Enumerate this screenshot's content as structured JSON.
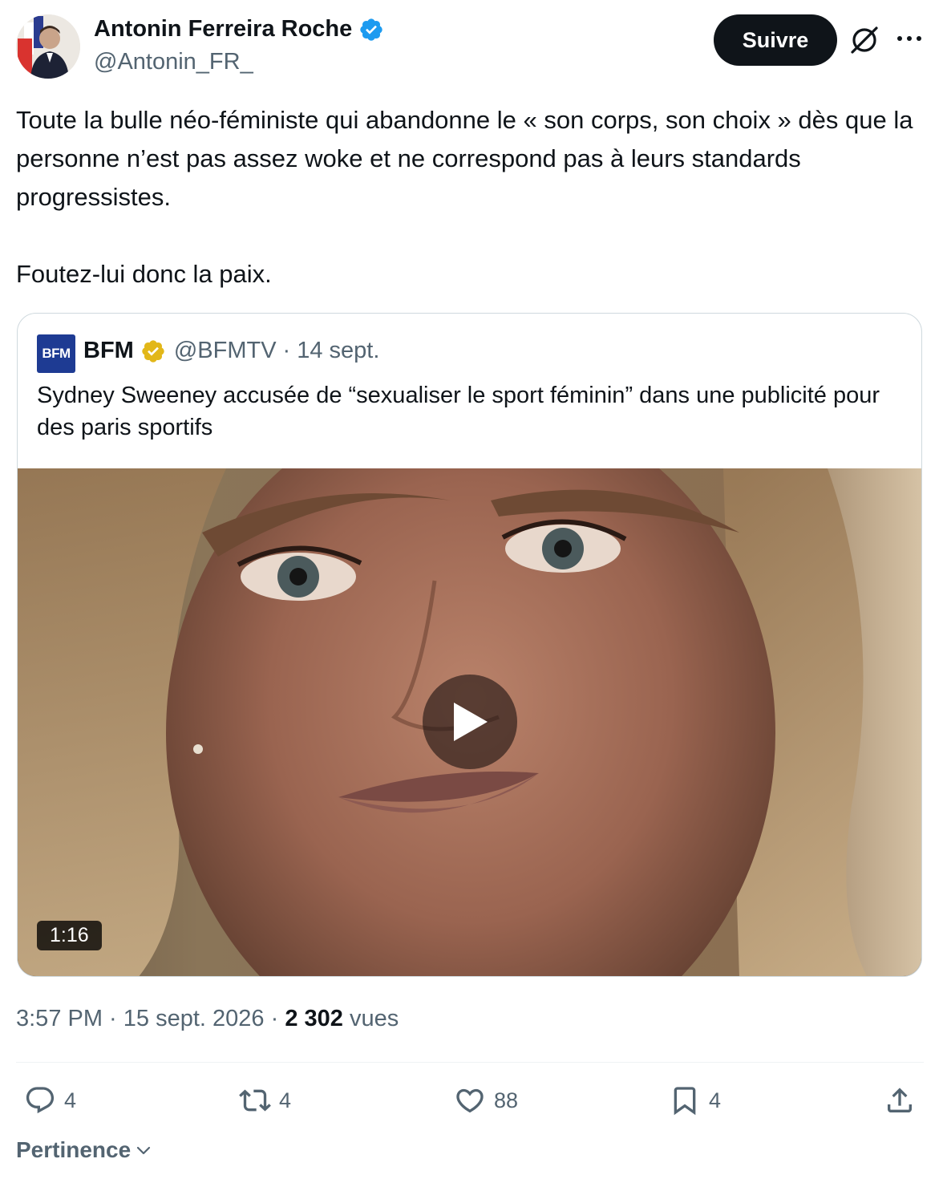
{
  "author": {
    "name": "Antonin Ferreira Roche",
    "handle": "@Antonin_FR_",
    "verified_color": "#1d9bf0"
  },
  "follow_button": {
    "label": "Suivre"
  },
  "tweet": {
    "paragraphs": [
      "Toute la bulle néo-féministe qui abandonne le « son corps, son choix » dès que la personne n’est pas assez woke et ne correspond pas à leurs standards progressistes.",
      "Foutez-lui donc la paix."
    ]
  },
  "quote": {
    "logo_text": "BFM",
    "name": "BFM",
    "handle": "@BFMTV",
    "separator": "·",
    "date": "14 sept.",
    "text": "Sydney Sweeney accusée de “sexualiser le sport féminin” dans une publicité pour des paris sportifs",
    "verified_color": "#e2b719",
    "video_duration": "1:16"
  },
  "meta": {
    "time": "3:57 PM",
    "sep1": " · ",
    "date": "15 sept. 2026",
    "sep2": " · ",
    "views_count": "2 302",
    "views_label": " vues"
  },
  "actions": {
    "replies": "4",
    "reposts": "4",
    "likes": "88",
    "bookmarks": "4"
  },
  "sort": {
    "label": "Pertinence"
  },
  "icons": [
    "verified-badge-icon",
    "grok-icon",
    "more-icon",
    "play-icon",
    "reply-icon",
    "repost-icon",
    "like-icon",
    "bookmark-icon",
    "share-icon",
    "chevron-down-icon"
  ]
}
